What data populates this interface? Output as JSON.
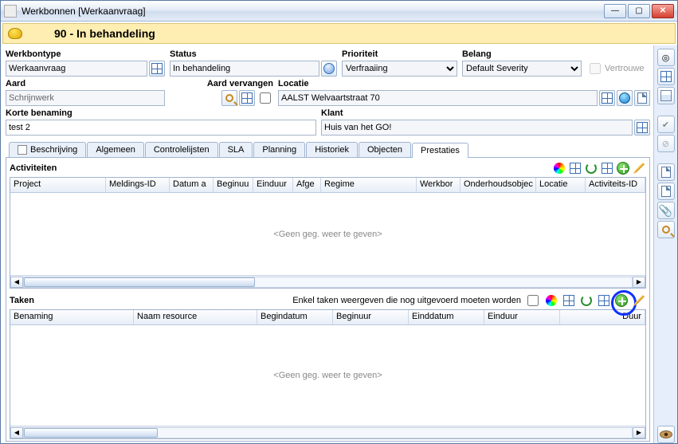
{
  "window": {
    "title": "Werkbonnen [Werkaanvraag]"
  },
  "banner": {
    "status_text": "90 - In behandeling"
  },
  "labels": {
    "werkbontype": "Werkbontype",
    "status": "Status",
    "prioriteit": "Prioriteit",
    "belang": "Belang",
    "vertrouwelijk": "Vertrouwe",
    "aard": "Aard",
    "aard_vervangen": "Aard vervangen",
    "locatie": "Locatie",
    "korte_benaming": "Korte benaming",
    "klant": "Klant"
  },
  "values": {
    "werkbontype": "Werkaanvraag",
    "status": "In behandeling",
    "prioriteit": "Verfraaiing",
    "belang": "Default Severity",
    "aard": "Schrijnwerk",
    "locatie": "AALST Welvaartstraat 70",
    "korte_benaming": "test 2",
    "klant": "Huis van het GO!"
  },
  "tabs": [
    "Beschrijving",
    "Algemeen",
    "Controlelijsten",
    "SLA",
    "Planning",
    "Historiek",
    "Objecten",
    "Prestaties"
  ],
  "active_tab": "Prestaties",
  "activiteiten": {
    "title": "Activiteiten",
    "columns": [
      "Project",
      "Meldings-ID",
      "Datum a",
      "Beginuu",
      "Einduur",
      "Afge",
      "Regime",
      "Werkbor",
      "Onderhoudsobjec",
      "Locatie",
      "Activiteits-ID"
    ],
    "empty_text": "<Geen geg. weer te geven>"
  },
  "taken": {
    "title": "Taken",
    "filter_label": "Enkel taken weergeven die nog uitgevoerd moeten worden",
    "columns": [
      "Benaming",
      "Naam resource",
      "Begindatum",
      "Beginuur",
      "Einddatum",
      "Einduur",
      "Duur"
    ],
    "empty_text": "<Geen geg. weer te geven>"
  }
}
